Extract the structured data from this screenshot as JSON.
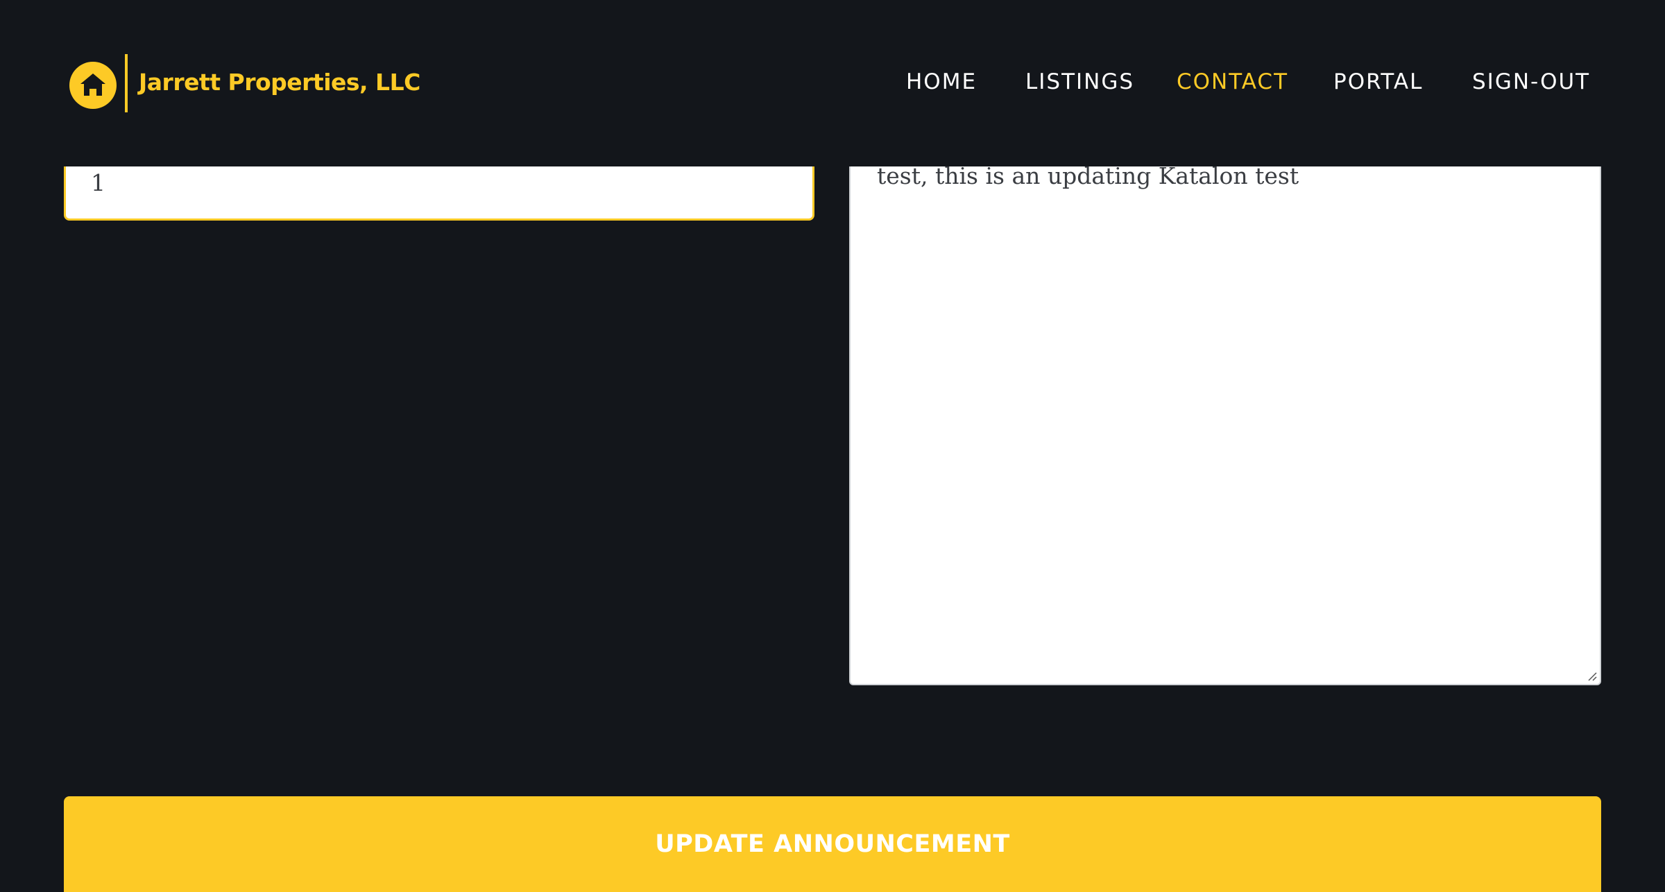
{
  "brand": {
    "name": "Jarrett Properties, LLC",
    "logo_icon": "house-icon",
    "accent_color": "#fdca26"
  },
  "nav": {
    "items": [
      {
        "label": "HOME",
        "active": false
      },
      {
        "label": "LISTINGS",
        "active": false
      },
      {
        "label": "CONTACT",
        "active": true
      },
      {
        "label": "PORTAL",
        "active": false
      },
      {
        "label": "SIGN-OUT",
        "active": false
      }
    ]
  },
  "form": {
    "order_value": "1",
    "message_value": "test, this is an updating Katalon test",
    "submit_label": "UPDATE ANNOUNCEMENT"
  },
  "colors": {
    "background": "#13161b",
    "accent": "#fdca26",
    "nav_text": "#ffffff"
  }
}
